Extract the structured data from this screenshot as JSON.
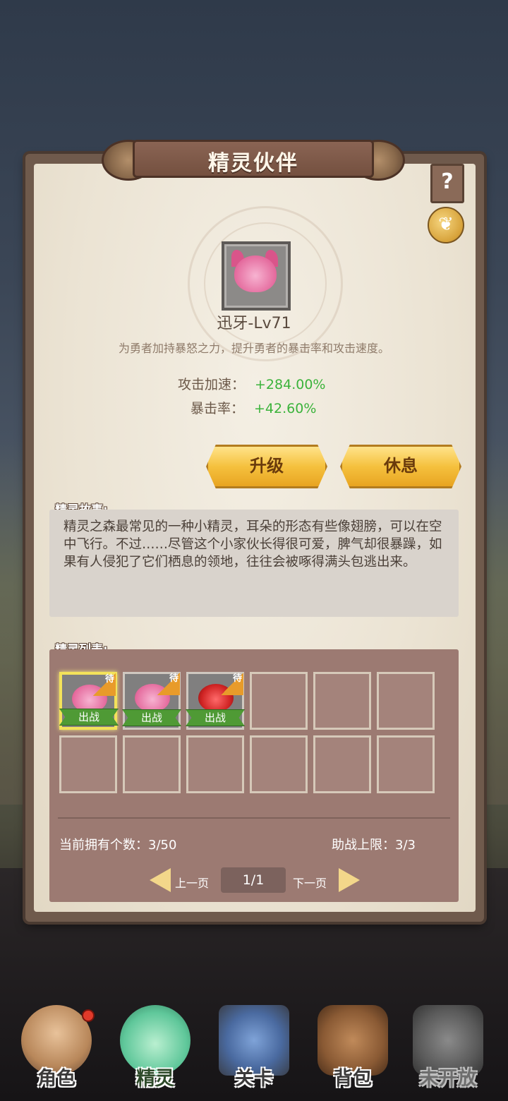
{
  "panel": {
    "title": "精灵伙伴",
    "help_label": "?",
    "pet_name": "迅牙-Lv71",
    "pet_desc": "为勇者加持暴怒之力，提升勇者的暴击率和攻击速度。",
    "stats": [
      {
        "label": "攻击加速：",
        "value": "+284.00%"
      },
      {
        "label": "暴击率：",
        "value": "+42.60%"
      }
    ],
    "buttons": {
      "upgrade": "升级",
      "rest": "休息"
    },
    "story_label": "精灵故事:",
    "story_text": "精灵之森最常见的一种小精灵，耳朵的形态有些像翅膀，可以在空中飞行。不过……尽管这个小家伙长得很可爱，脾气却很暴躁，如果有人侵犯了它们栖息的领地，往往会被啄得满头包逃出来。",
    "list_label": "精灵列表:",
    "slots": [
      {
        "wait": "待",
        "deploy": "出战",
        "color": "pink"
      },
      {
        "wait": "待",
        "deploy": "出战",
        "color": "pink"
      },
      {
        "wait": "待",
        "deploy": "出战",
        "color": "red"
      }
    ],
    "owned_count": "当前拥有个数：3/50",
    "assist_limit": "助战上限：3/3",
    "pager": {
      "prev": "上一页",
      "page": "1/1",
      "next": "下一页"
    }
  },
  "nav": [
    {
      "label": "角色",
      "icon": "hero-portrait-icon"
    },
    {
      "label": "精灵",
      "icon": "slime-icon"
    },
    {
      "label": "关卡",
      "icon": "crossed-swords-icon"
    },
    {
      "label": "背包",
      "icon": "backpack-icon"
    },
    {
      "label": "未开放",
      "icon": "locked-icon"
    }
  ],
  "colors": {
    "stat_value": "#3bb33b",
    "gold_button": "#f5c13e",
    "panel_frame": "#6f5a4c"
  }
}
